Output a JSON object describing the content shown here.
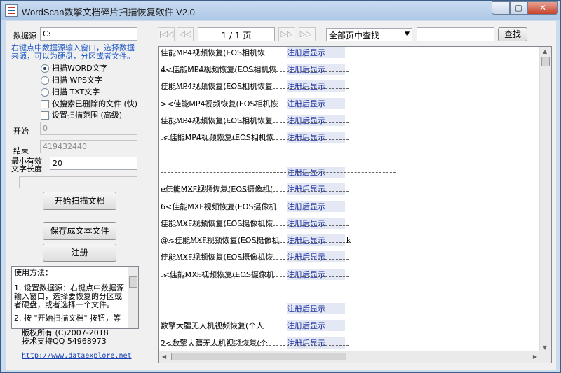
{
  "window": {
    "title": "WordScan数擎文档碎片扫描恢复软件 V2.0",
    "min_glyph": "—",
    "max_glyph": "▢",
    "close_glyph": "✕"
  },
  "left": {
    "datasource_label": "数据源",
    "datasource_value": "C:",
    "hint_line1": "右键点中数据源输入窗口，选择数据",
    "hint_line2": "来源，可以为硬盘，分区或者文件。",
    "radios": [
      {
        "label": "扫描WORD文字",
        "checked": true
      },
      {
        "label": "扫描 WPS文字",
        "checked": false
      },
      {
        "label": "扫描 TXT文字",
        "checked": false
      }
    ],
    "checks": [
      {
        "label": "仅搜索已删除的文件 (快)"
      },
      {
        "label": "设置扫描范围 (高级)"
      }
    ],
    "start_label": "开始",
    "start_value": "0",
    "end_label": "结束",
    "end_value": "419432440",
    "minlen_label_1": "最小有效",
    "minlen_label_2": "文字长度",
    "minlen_value": "20",
    "scan_button": "开始扫描文档",
    "save_button": "保存成文本文件",
    "register_button": "注册",
    "help_lines": [
      "使用方法：",
      "",
      "1. 设置数据源：右键点中数据源",
      "输入窗口，选择要恢复的分区或",
      "者硬盘，或者选择一个文件。",
      "",
      "2. 按 \"开始扫描文档\" 按钮，等"
    ],
    "copyright": "版权所有 (C)2007-2018",
    "support": "技术支持QQ 54968973",
    "website": "http://www.dataexplore.net"
  },
  "toolbar": {
    "first": "|◁◁",
    "prev": "◁◁",
    "page": "1 / 1 页",
    "next": "▷▷",
    "last": "▷▷|",
    "scope_select": "全部页中查找",
    "search_value": "",
    "search_button": "查找"
  },
  "results": {
    "register_label": "注册后显示",
    "rows": [
      {
        "text": "佳能MP4视频恢复(EOS相机恢",
        "reg": true
      },
      {
        "text": "4<佳能MP4视频恢复(EOS相机恢",
        "reg": true
      },
      {
        "text": "佳能MP4视频恢复(EOS相机恢复",
        "reg": true
      },
      {
        "text": "><佳能MP4视频恢复(EOS相机恢",
        "reg": true
      },
      {
        "text": "佳能MP4视频恢复(EOS相机恢复",
        "reg": true
      },
      {
        "text": ".<佳能MP4视频恢复(EOS相机恢",
        "reg": true
      },
      {
        "text": "",
        "reg": true
      },
      {
        "text": "e佳能MXF视频恢复(EOS摄像机(",
        "reg": true
      },
      {
        "text": "6<佳能MXF视频恢复(EOS摄像机",
        "reg": true
      },
      {
        "text": "佳能MXF视频恢复(EOS摄像机恢",
        "reg": true
      },
      {
        "text": "@<佳能MXF视频恢复(EOS摄像机",
        "reg": true
      },
      {
        "text": "佳能MXF视频恢复(EOS摄像机恢",
        "reg": true
      },
      {
        "text": ".<佳能MXF视频恢复(EOS摄像机",
        "reg": true
      },
      {
        "text": "",
        "reg": true
      },
      {
        "text": "数擎大疆无人机视频恢复(个人",
        "reg": true
      },
      {
        "text": "2<数擎大疆无人机视频恢复(个",
        "reg": true
      }
    ],
    "stray_char": "k"
  },
  "scroll": {
    "up": "▲",
    "down": "▼",
    "left": "◀",
    "right": "▶"
  }
}
